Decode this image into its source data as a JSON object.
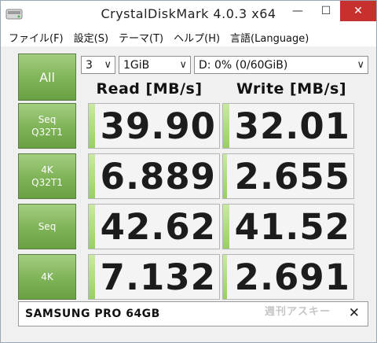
{
  "window": {
    "title": "CrystalDiskMark 4.0.3 x64",
    "minimize_glyph": "—",
    "maximize_glyph": "☐",
    "close_glyph": "✕",
    "close_color": "#c7312d"
  },
  "menu": {
    "items": [
      "ファイル(F)",
      "設定(S)",
      "テーマ(T)",
      "ヘルプ(H)",
      "言語(Language)"
    ]
  },
  "controls": {
    "all_label": "All",
    "test_count": "3",
    "test_size": "1GiB",
    "drive": "D: 0% (0/60GiB)",
    "chevron_glyph": "∨"
  },
  "headers": {
    "read": "Read [MB/s]",
    "write": "Write [MB/s]"
  },
  "rows": [
    {
      "label_line1": "Seq",
      "label_line2": "Q32T1",
      "read": "39.90",
      "write": "32.01",
      "read_fill": 0.05,
      "write_fill": 0.05
    },
    {
      "label_line1": "4K",
      "label_line2": "Q32T1",
      "read": "6.889",
      "write": "2.655",
      "read_fill": 0.05,
      "write_fill": 0.03
    },
    {
      "label_line1": "Seq",
      "label_line2": "",
      "read": "42.62",
      "write": "41.52",
      "read_fill": 0.05,
      "write_fill": 0.05
    },
    {
      "label_line1": "4K",
      "label_line2": "",
      "read": "7.132",
      "write": "2.691",
      "read_fill": 0.05,
      "write_fill": 0.03
    }
  ],
  "comment": {
    "text": "SAMSUNG PRO 64GB",
    "clear_glyph": "✕"
  },
  "watermark": "週刊アスキー",
  "colors": {
    "accent_green": "#7fb357",
    "bar_green": "#98cf64"
  }
}
